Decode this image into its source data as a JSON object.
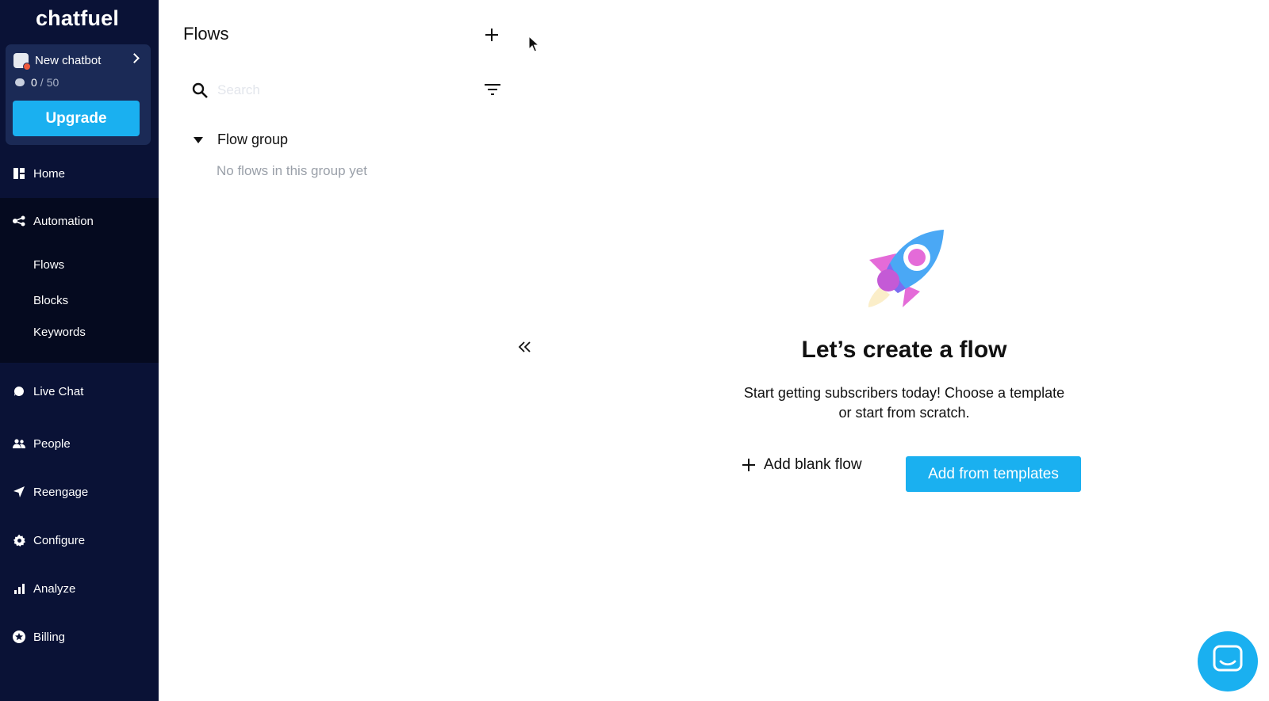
{
  "brand": {
    "logo_text": "chatfuel"
  },
  "bot": {
    "name": "New chatbot",
    "messages_used": "0",
    "messages_separator": "/",
    "messages_limit": "50",
    "upgrade_label": "Upgrade"
  },
  "nav": {
    "home": "Home",
    "automation": "Automation",
    "flows": "Flows",
    "blocks": "Blocks",
    "keywords": "Keywords",
    "live_chat": "Live Chat",
    "people": "People",
    "reengage": "Reengage",
    "configure": "Configure",
    "analyze": "Analyze",
    "billing": "Billing"
  },
  "panel": {
    "title": "Flows",
    "search_placeholder": "Search",
    "group_label": "Flow group",
    "empty_group_text": "No flows in this group yet"
  },
  "empty_state": {
    "title": "Let’s create a flow",
    "subtitle_line1": "Start getting subscribers today! Choose a template",
    "subtitle_line2": "or start from scratch.",
    "add_blank_label": "Add blank flow",
    "add_templates_label": "Add from templates"
  },
  "colors": {
    "sidebar_bg": "#0a1236",
    "automation_bg": "#050a1f",
    "accent": "#1ab0f0",
    "muted_text": "#9aa0a9"
  },
  "icons": [
    "grid-icon",
    "automation-icon",
    "chat-bubble-icon",
    "people-icon",
    "paper-plane-icon",
    "gear-icon",
    "bar-chart-icon",
    "star-badge-icon",
    "plus-icon",
    "search-icon",
    "filter-icon",
    "double-chevron-left-icon",
    "rocket-icon",
    "chat-launcher-icon"
  ]
}
